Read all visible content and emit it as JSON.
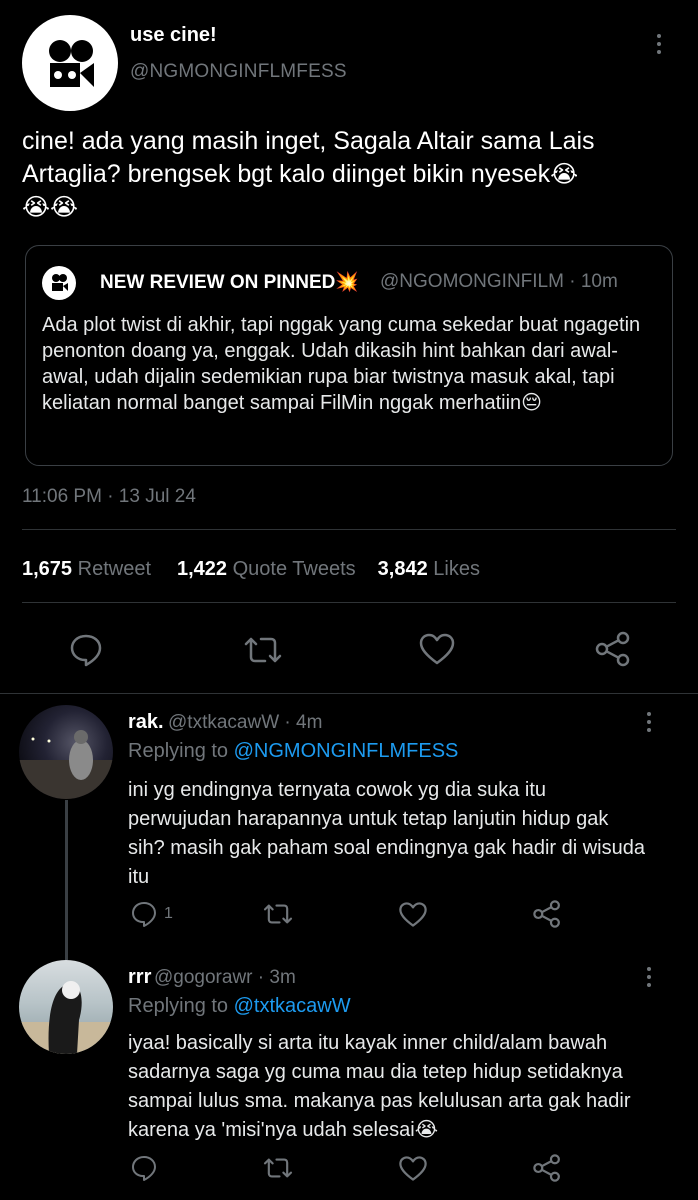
{
  "tweet": {
    "author_name": "use cine!",
    "author_handle": "@NGMONGINFLMFESS",
    "text": "cine! ada yang masih inget, Sagala Altair sama Lais Artaglia? brengsek bgt kalo diinget bikin nyesek",
    "text_emoji_1": "😭",
    "text_emoji_2": "😭😭",
    "timestamp": "11:06 PM · 13 Jul 24",
    "quote": {
      "name": "NEW REVIEW ON PINNED",
      "name_emoji": "💥",
      "handle_time": "@NGOMONGINFILM · 10m",
      "text": "Ada plot twist di akhir, tapi nggak yang cuma sekedar buat ngagetin penonton doang ya, enggak. Udah dikasih hint bahkan dari awal-awal, udah dijalin sedemikian rupa biar twistnya masuk akal, tapi keliatan normal banget sampai FilMin nggak merhatiin",
      "text_emoji": "😔"
    },
    "stats": {
      "retweets": "1,675",
      "retweets_label": "Retweet",
      "quotes": "1,422",
      "quotes_label": "Quote Tweets",
      "likes": "3,842",
      "likes_label": "Likes"
    }
  },
  "replies": [
    {
      "name": "rak.",
      "handle_time": "@txtkacawW · 4m",
      "replying_prefix": "Replying to",
      "replying_to": "@NGMONGINFLMFESS",
      "text": "ini yg endingnya ternyata cowok yg dia suka itu perwujudan harapannya untuk tetap lanjutin hidup gak sih? masih gak paham soal endingnya gak hadir di wisuda itu",
      "reply_count": "1"
    },
    {
      "name": "rrr",
      "handle_time": "@gogorawr · 3m",
      "replying_prefix": "Replying to",
      "replying_to": "@txtkacawW",
      "text": "iyaa! basically si arta itu kayak inner child/alam bawah sadarnya saga yg cuma mau dia tetep hidup setidaknya sampai lulus sma. makanya pas kelulusan arta gak hadir karena ya 'misi'nya udah selesai",
      "text_emoji": "😭"
    }
  ],
  "icons": [
    "more-icon",
    "reply-icon",
    "retweet-icon",
    "like-icon",
    "share-icon",
    "camera-logo-icon"
  ],
  "colors": {
    "background": "#000000",
    "text": "#e7e9ea",
    "muted": "#71767b",
    "link": "#1d9bf0",
    "divider": "#2f3336"
  }
}
